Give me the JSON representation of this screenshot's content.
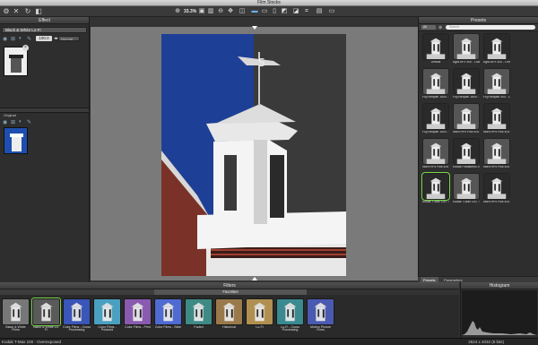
{
  "window": {
    "title": "Film Stocks"
  },
  "zoom": {
    "label": "33.3%"
  },
  "effect": {
    "header": "Effect",
    "preset_name": "Black & White Lo-Fi",
    "opacity": "100.0",
    "blend": "Normal"
  },
  "original": {
    "header": "Original"
  },
  "presets": {
    "header": "Presets",
    "filter": "All",
    "search_placeholder": "Search",
    "items": [
      "Default",
      "Agfa APX 400 - Low...",
      "Agfa APX 400 - Lomo LCA",
      "Fuji Neopan 1600 - Unde...",
      "Fuji Neopan 1600 - Lomo",
      "Fuji Neopan 400 - Overex...",
      "Fuji Neopan 1600 - Unde...",
      "Ilford HP5 Plus 400 - Stand H+",
      "Ilford HP5 Plus 400 - Overexp...",
      "Ilford HP5 Plus 400 - Unde...",
      "Kodak Panatomic-X9",
      "Ilford HP5 Plus 400 - Portra 120",
      "Kodak T-Max 100 - Overexp...",
      "Kodak T-Max 100 - Underex...",
      "Ilford HP5 Plus 400 - Underex..."
    ],
    "tabs": [
      "Presets",
      "Parameters"
    ]
  },
  "filters": {
    "header": "Filters",
    "tab": "Favorites",
    "items": [
      "Black & White Films",
      "Black & White Lo-Fi",
      "Color Films - Cross Processing",
      "Color Films - Polaroid",
      "Color Films - Print",
      "Color Films - Slide",
      "Faded",
      "Historical",
      "Lo-Fi",
      "Lo-Fi - Cross Processing",
      "Motion Picture Films"
    ]
  },
  "histogram": {
    "header": "Histogram"
  },
  "status": {
    "left": "Kodak T-Max 100 - Overexposed",
    "right": "2624 x 4032 (8 bits)"
  },
  "icons": {
    "toolbar": [
      "gear-icon",
      "close-icon",
      "refresh-icon",
      "compare-icon"
    ]
  }
}
